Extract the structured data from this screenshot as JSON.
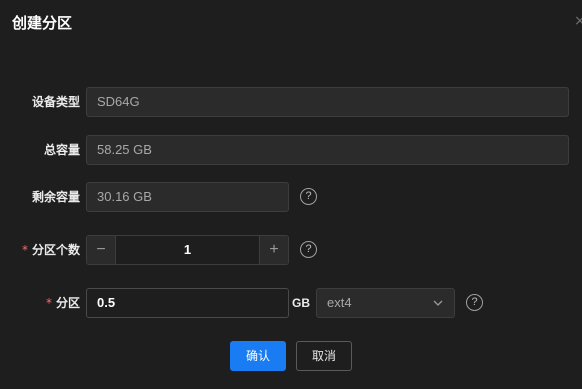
{
  "dialog": {
    "title": "创建分区",
    "close_glyph": "×"
  },
  "form": {
    "device_type": {
      "label": "设备类型",
      "value": "SD64G"
    },
    "total_capacity": {
      "label": "总容量",
      "value": "58.25 GB"
    },
    "remaining_capacity": {
      "label": "剩余容量",
      "value": "30.16 GB",
      "help": "?"
    },
    "partition_count": {
      "required_mark": "*",
      "label": "分区个数",
      "value": "1",
      "minus": "−",
      "plus": "+",
      "help": "?"
    },
    "partition": {
      "required_mark": "*",
      "label": "分区",
      "size_value": "0.5",
      "unit": "GB",
      "filesystem": "ext4",
      "help": "?"
    }
  },
  "buttons": {
    "confirm": "确认",
    "cancel": "取消"
  },
  "colors": {
    "background": "#1e1e1e",
    "primary": "#1a7cf2",
    "required": "#f56c6c"
  }
}
